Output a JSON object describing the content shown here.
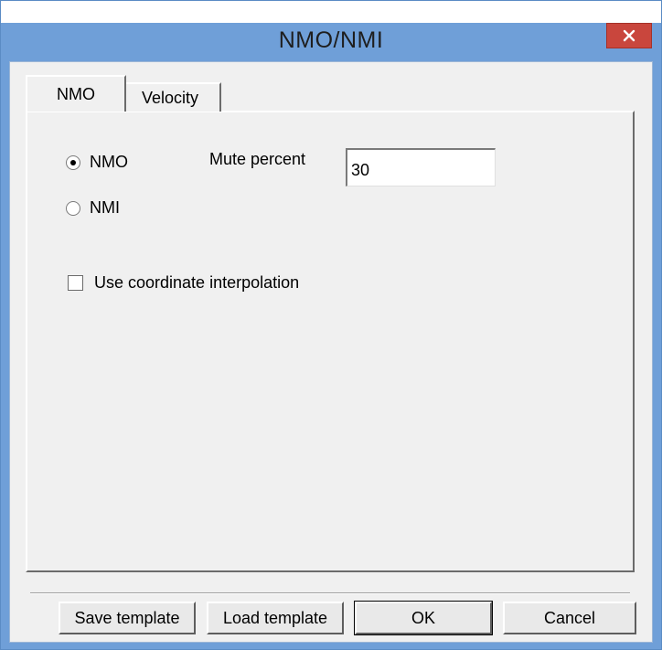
{
  "window": {
    "title": "NMO/NMI"
  },
  "tabs": [
    {
      "label": "NMO",
      "active": true
    },
    {
      "label": "Velocity",
      "active": false
    }
  ],
  "mode": {
    "options": [
      {
        "label": "NMO",
        "selected": true
      },
      {
        "label": "NMI",
        "selected": false
      }
    ]
  },
  "mute": {
    "label": "Mute percent",
    "value": "30"
  },
  "interpolation": {
    "label": "Use coordinate interpolation",
    "checked": false
  },
  "buttons": {
    "save_template": "Save template",
    "load_template": "Load template",
    "ok": "OK",
    "cancel": "Cancel"
  },
  "colors": {
    "title_bar": "#6f9fd8",
    "close_button": "#c9463d",
    "client": "#f0f0f0"
  }
}
